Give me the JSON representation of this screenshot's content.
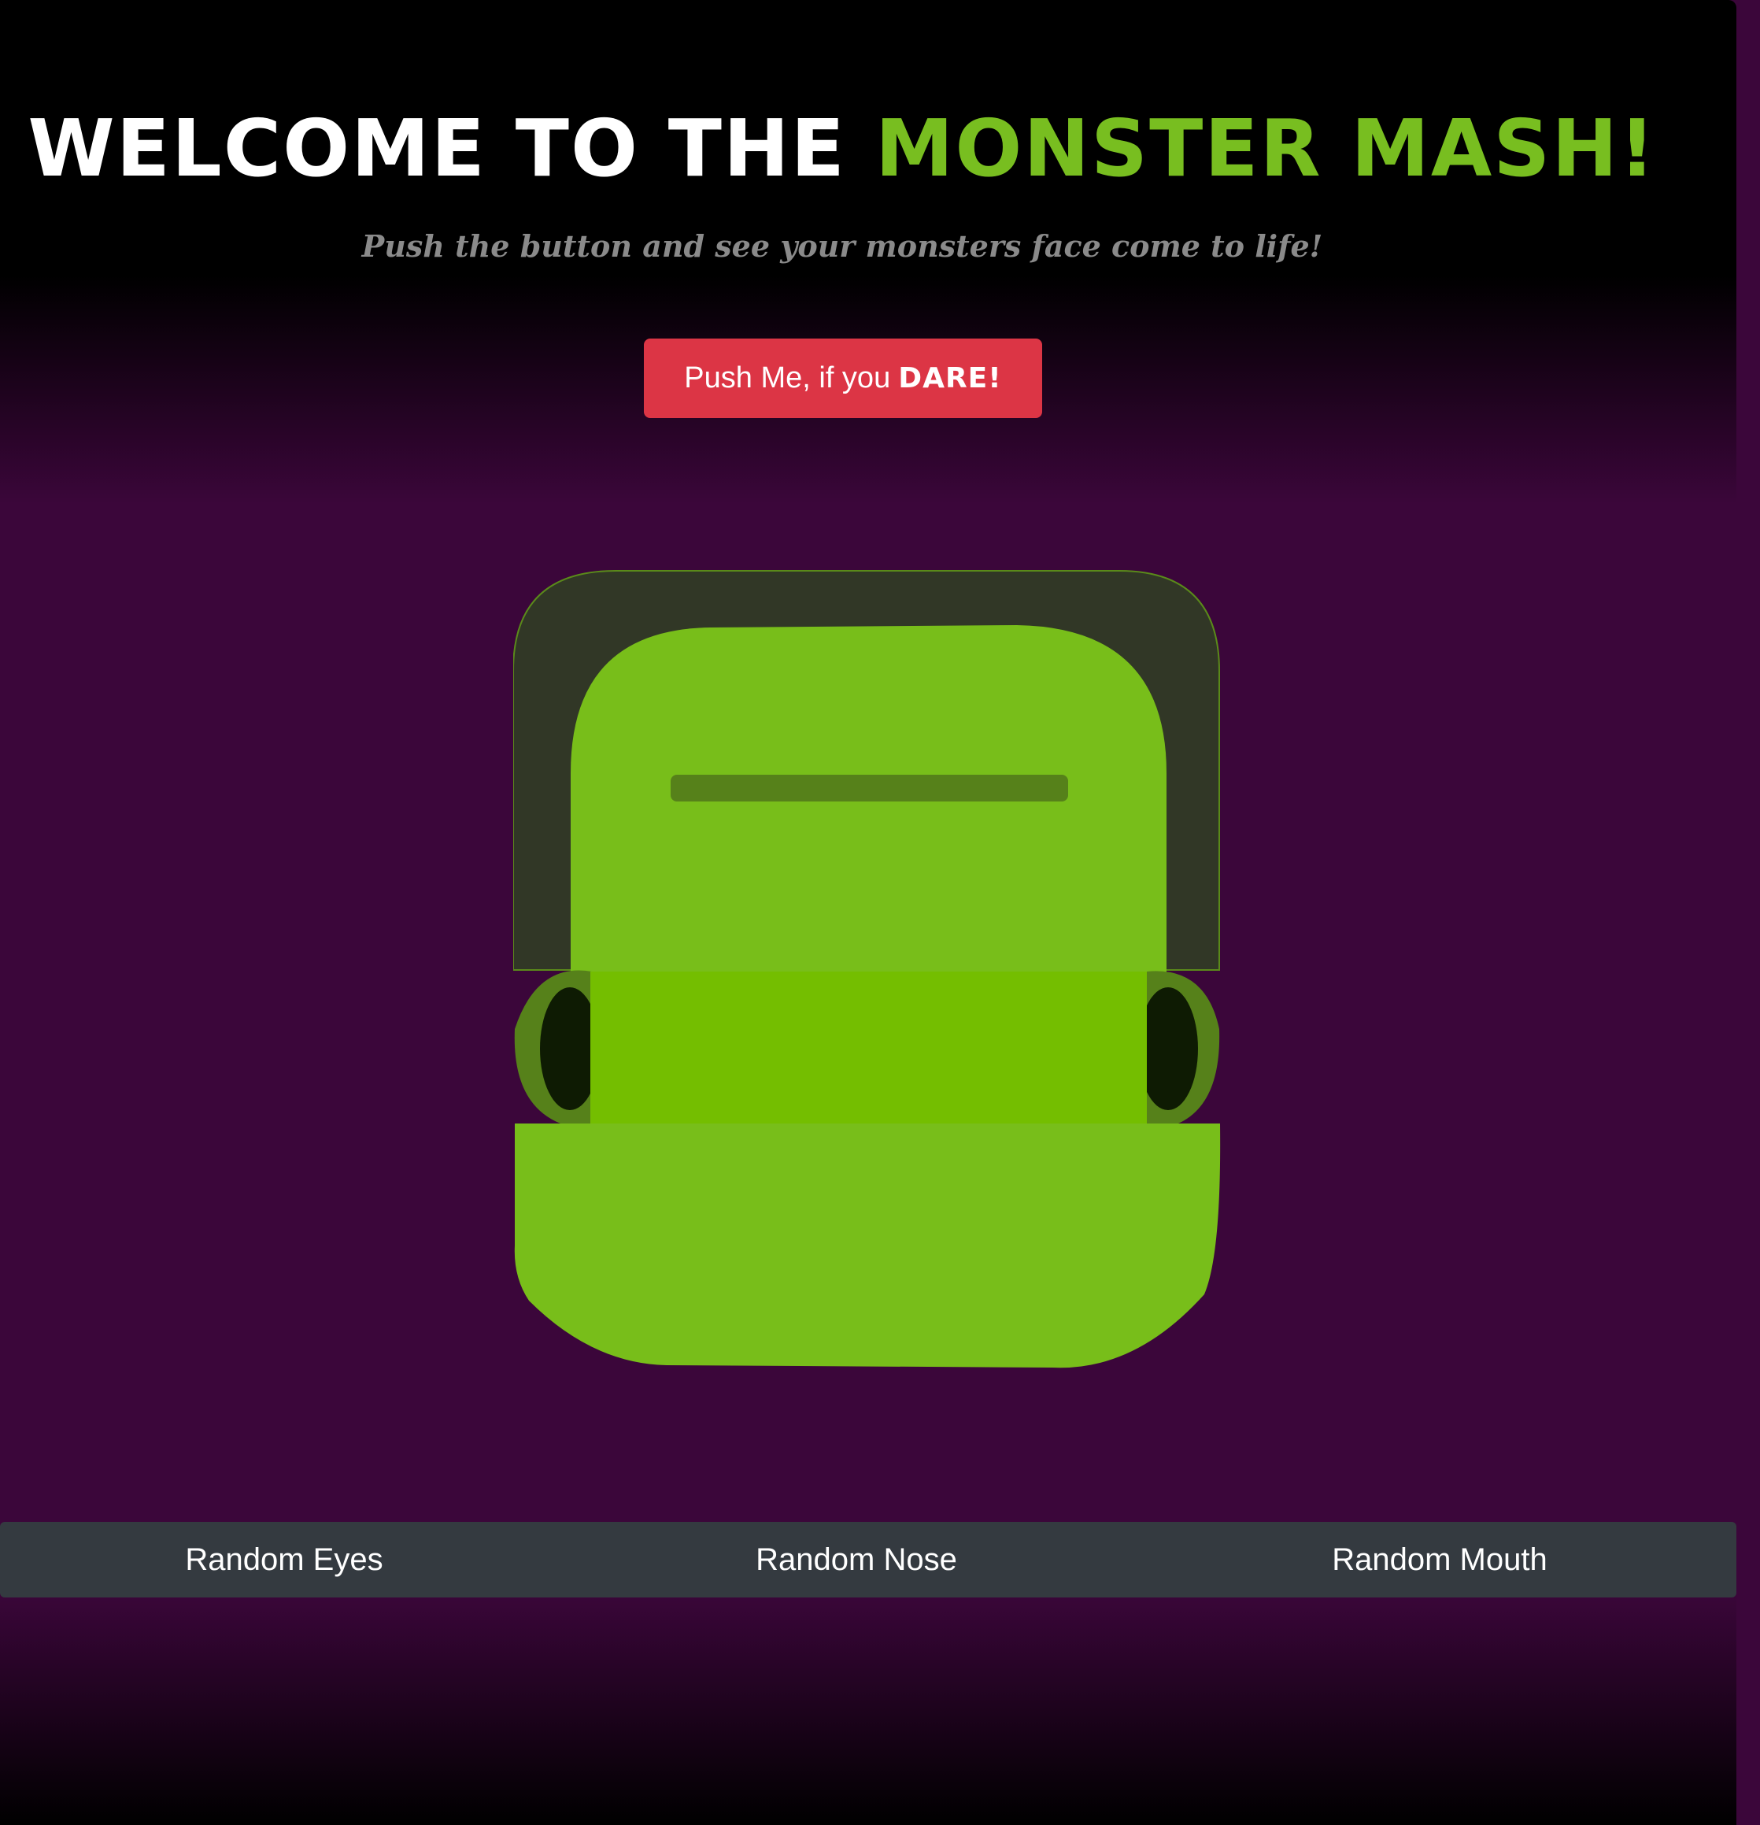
{
  "header": {
    "title_main": "WELCOME TO THE",
    "title_accent": "MONSTER MASH!",
    "subtitle": "Push the button and see your monsters face come to life!"
  },
  "action_button": {
    "label": "Push Me, if you",
    "emphasis": "DARE!"
  },
  "bottom_nav": {
    "items": [
      {
        "label": "Random Eyes"
      },
      {
        "label": "Random Nose"
      },
      {
        "label": "Random Mouth"
      }
    ]
  },
  "colors": {
    "accent_green": "#78be20",
    "button_red": "#dc3545",
    "background_purple": "#3b063a",
    "bar_gray": "#343a40"
  }
}
